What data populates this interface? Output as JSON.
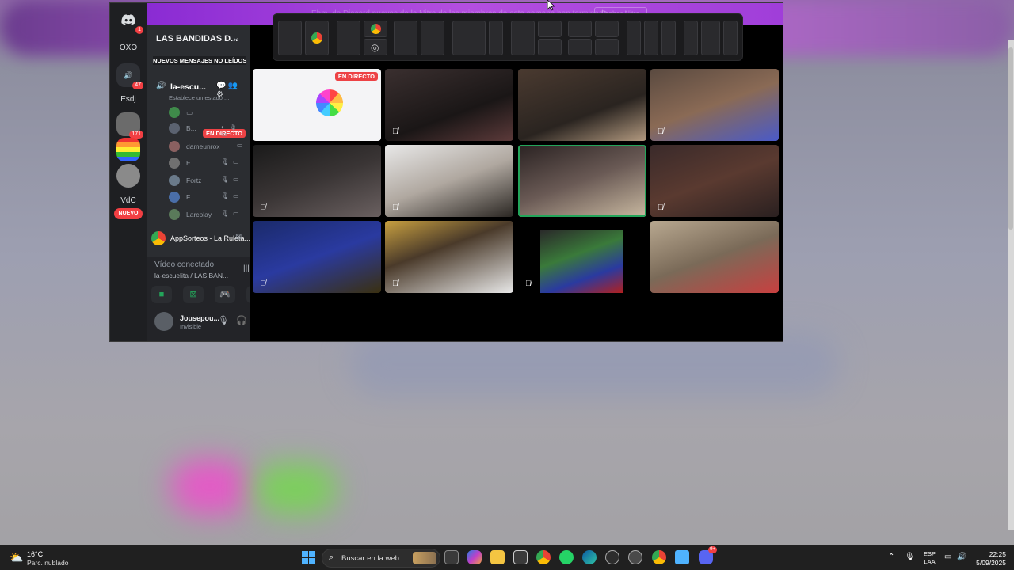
{
  "banner": {
    "text": "Ehm, de Discord nuevos de la Nitro de los miembros de esta semana han terminado",
    "button": "Probar Nitro",
    "close": "×"
  },
  "rail": {
    "home_badge": "1",
    "oxo": "OXO",
    "badge_47": "47",
    "esdj": "Esdj",
    "badge_171": "171",
    "vdc": "VdC",
    "new": "NUEVO"
  },
  "guild": {
    "name": "LAS BANDIDAS D...",
    "unread": "NUEVOS MENSAJES NO LEÍDOS",
    "voice_channel": "la-escu...",
    "status_placeholder": "Establece un estado ...",
    "live": "EN DIRECTO",
    "members": [
      "B...",
      "dameunrox",
      "E...",
      "Fortz",
      "F...",
      "Larcplay"
    ]
  },
  "activity": {
    "name": "AppSorteos - La Ruleta..."
  },
  "voice_panel": {
    "status": "Vídeo conectado",
    "channel": "la-escuelita / LAS BAN..."
  },
  "user": {
    "name": "Jousepou...",
    "status": "Invisible"
  },
  "stage": {
    "live_label": "EN DIRECTO"
  },
  "taskbar": {
    "temp": "16°C",
    "condition": "Parc. nublado",
    "search_placeholder": "Buscar en la web",
    "lang_top": "ESP",
    "lang_bottom": "LAA",
    "time": "22:25",
    "date": "5/09/2025",
    "discord_badge": "9+"
  }
}
